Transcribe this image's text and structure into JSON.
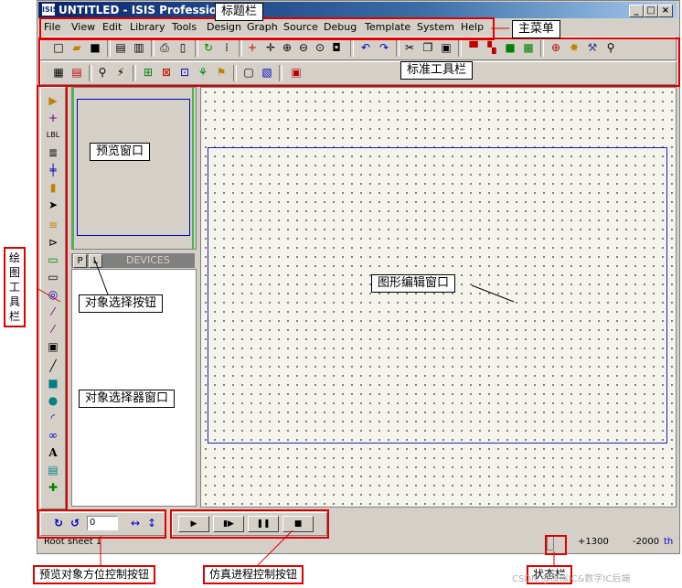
{
  "window": {
    "title": "UNTITLED - ISIS Professional",
    "app_icon": "ISIS",
    "controls": {
      "minimize": "_",
      "maximize": "□",
      "close": "×"
    }
  },
  "menu": {
    "items": [
      "File",
      "View",
      "Edit",
      "Library",
      "Tools",
      "Design",
      "Graph",
      "Source",
      "Debug",
      "Template",
      "System",
      "Help"
    ]
  },
  "devices_panel": {
    "header": "DEVICES",
    "p_button": "P",
    "l_button": "L"
  },
  "orientation": {
    "value": "0"
  },
  "status": {
    "sheet": "Root sheet 1",
    "x": "+1300",
    "y": "-2000",
    "unit": "th"
  },
  "annotations": {
    "title_bar": "标题栏",
    "main_menu": "主菜单",
    "standard_toolbar": "标准工具栏",
    "preview_window": "预览窗口",
    "object_select_button": "对象选择按钮",
    "object_selector_window": "对象选择器窗口",
    "graphics_edit_window": "图形编辑窗口",
    "drawing_toolbar": "绘图工具栏",
    "preview_orientation_controls": "预览对象方位控制按钮",
    "simulation_controls": "仿真进程控制按钮",
    "status_bar": "状态栏"
  },
  "watermark": "CSDN @模拟IC&数字IC后端",
  "colors": {
    "title_gradient_start": "#0a246a",
    "chrome": "#d4d0c8",
    "annotation_red": "#e00000",
    "sheet_border": "#2020b0",
    "grid_background": "#f4f4ec"
  },
  "icons": [
    "new-file-icon",
    "open-folder-icon",
    "save-icon",
    "import-icon",
    "export-icon",
    "print-icon",
    "area-icon",
    "refresh-icon",
    "grid-icon",
    "origin-icon",
    "pan-icon",
    "zoom-in-icon",
    "zoom-out-icon",
    "zoom-all-icon",
    "zoom-area-icon",
    "undo-icon",
    "redo-icon",
    "cut-icon",
    "copy-icon",
    "paste-icon",
    "block-copy-icon",
    "block-move-icon",
    "block-rotate-icon",
    "block-delete-icon",
    "pick-device-icon",
    "make-device-icon",
    "packaging-icon",
    "decompose-icon"
  ]
}
